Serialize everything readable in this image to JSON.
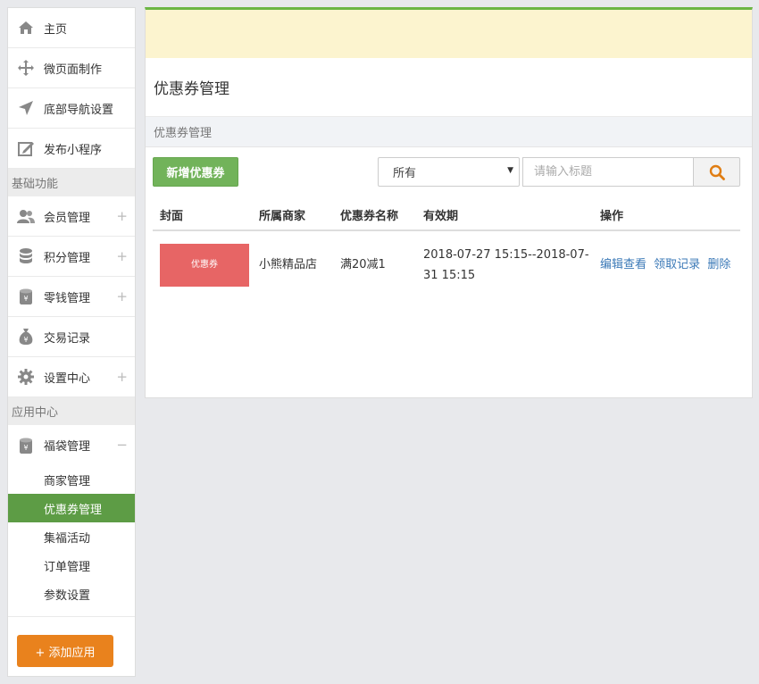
{
  "sidebar": {
    "top_items": [
      {
        "label": "主页",
        "icon": "home-icon"
      },
      {
        "label": "微页面制作",
        "icon": "move-icon"
      },
      {
        "label": "底部导航设置",
        "icon": "location-arrow-icon"
      },
      {
        "label": "发布小程序",
        "icon": "edit-icon"
      }
    ],
    "section_basic": "基础功能",
    "basic_items": [
      {
        "label": "会员管理",
        "icon": "users-icon",
        "expand": "+"
      },
      {
        "label": "积分管理",
        "icon": "database-icon",
        "expand": "+"
      },
      {
        "label": "零钱管理",
        "icon": "yen-jar-icon",
        "expand": "+"
      },
      {
        "label": "交易记录",
        "icon": "money-bag-icon"
      },
      {
        "label": "设置中心",
        "icon": "gear-icon",
        "expand": "+"
      }
    ],
    "section_app": "应用中心",
    "app_group": {
      "label": "福袋管理",
      "icon": "yen-jar-icon",
      "expand": "−"
    },
    "app_sub_items": [
      "商家管理",
      "优惠券管理",
      "集福活动",
      "订单管理",
      "参数设置"
    ],
    "active_sub_item": "优惠券管理",
    "add_app_label": "+ 添加应用"
  },
  "main": {
    "page_title": "优惠券管理",
    "sub_header": "优惠券管理",
    "add_button": "新增优惠券",
    "filter_select": "所有",
    "search_placeholder": "请输入标题",
    "table": {
      "headers": [
        "封面",
        "所属商家",
        "优惠券名称",
        "有效期",
        "操作"
      ],
      "rows": [
        {
          "cover_text": "优惠券",
          "merchant": "小熊精品店",
          "name": "满20减1",
          "validity": "2018-07-27 15:15--2018-07-31 15:15",
          "actions": [
            "编辑查看",
            "领取记录",
            "删除"
          ]
        }
      ]
    }
  },
  "colors": {
    "accent_green": "#5d9c45",
    "button_green": "#72b35a",
    "orange": "#e9821d",
    "cover_red": "#e76565",
    "link_blue": "#3b79b7",
    "notice_yellow": "#fcf4cf"
  }
}
